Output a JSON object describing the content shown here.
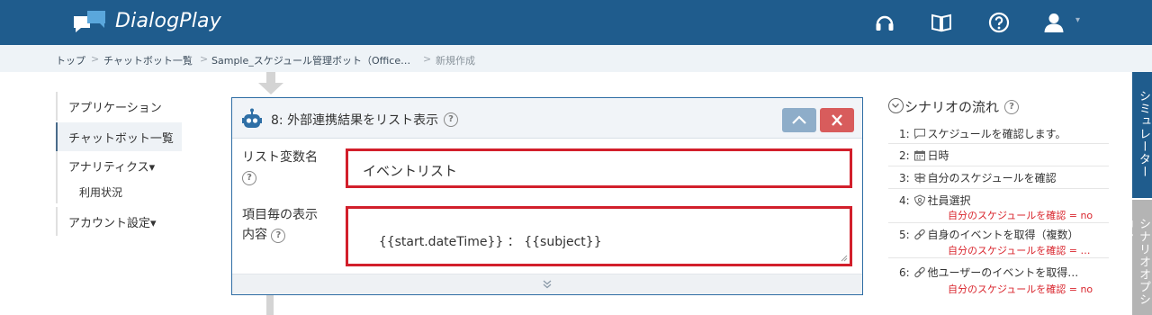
{
  "app": {
    "brand": "DialogPlay"
  },
  "header": {
    "icons": [
      "headset-icon",
      "book-icon",
      "help-icon",
      "user-icon"
    ],
    "colors": {
      "header_bg": "#1f5c8d"
    }
  },
  "breadcrumb": {
    "items": [
      "トップ",
      "チャットボット一覧",
      "Sample_スケジュール管理ボット（Office…",
      "新規作成"
    ],
    "separator": ">"
  },
  "sidebar": {
    "items": [
      {
        "label": "アプリケーション"
      },
      {
        "label": "チャットボット一覧"
      },
      {
        "label": "アナリティクス▾"
      },
      {
        "label": "利用状況"
      },
      {
        "label": "アカウント設定▾"
      }
    ]
  },
  "card": {
    "number_title": "8: 外部連携結果をリスト表示",
    "help": "?",
    "fields": [
      {
        "label_line1": "リスト変数名",
        "label_line2": "",
        "value": "イベントリスト"
      },
      {
        "label_line1": "項目毎の表示",
        "label_line2": "内容",
        "value": "{{start.dateTime}} ： {{subject}}"
      }
    ]
  },
  "flow": {
    "title": "シナリオの流れ",
    "help": "?",
    "items": [
      {
        "num": "1:",
        "icon": "speech-bubble-icon",
        "label": "スケジュールを確認します。",
        "condition": ""
      },
      {
        "num": "2:",
        "icon": "calendar-icon",
        "label": "日時",
        "condition": ""
      },
      {
        "num": "3:",
        "icon": "signpost-icon",
        "label": "自分のスケジュールを確認",
        "condition": ""
      },
      {
        "num": "4:",
        "icon": "shield-icon",
        "label": "社員選択",
        "condition": "自分のスケジュールを確認 = no"
      },
      {
        "num": "5:",
        "icon": "link-icon",
        "label": "自身のイベントを取得（複数）",
        "condition": "自分のスケジュールを確認 = …"
      },
      {
        "num": "6:",
        "icon": "link-icon",
        "label": "他ユーザーのイベントを取得…",
        "condition": "自分のスケジュールを確認 = no"
      }
    ]
  },
  "right_tabs": {
    "simulator": "シミュレーター",
    "scenario_options": "シナリオオプション"
  }
}
